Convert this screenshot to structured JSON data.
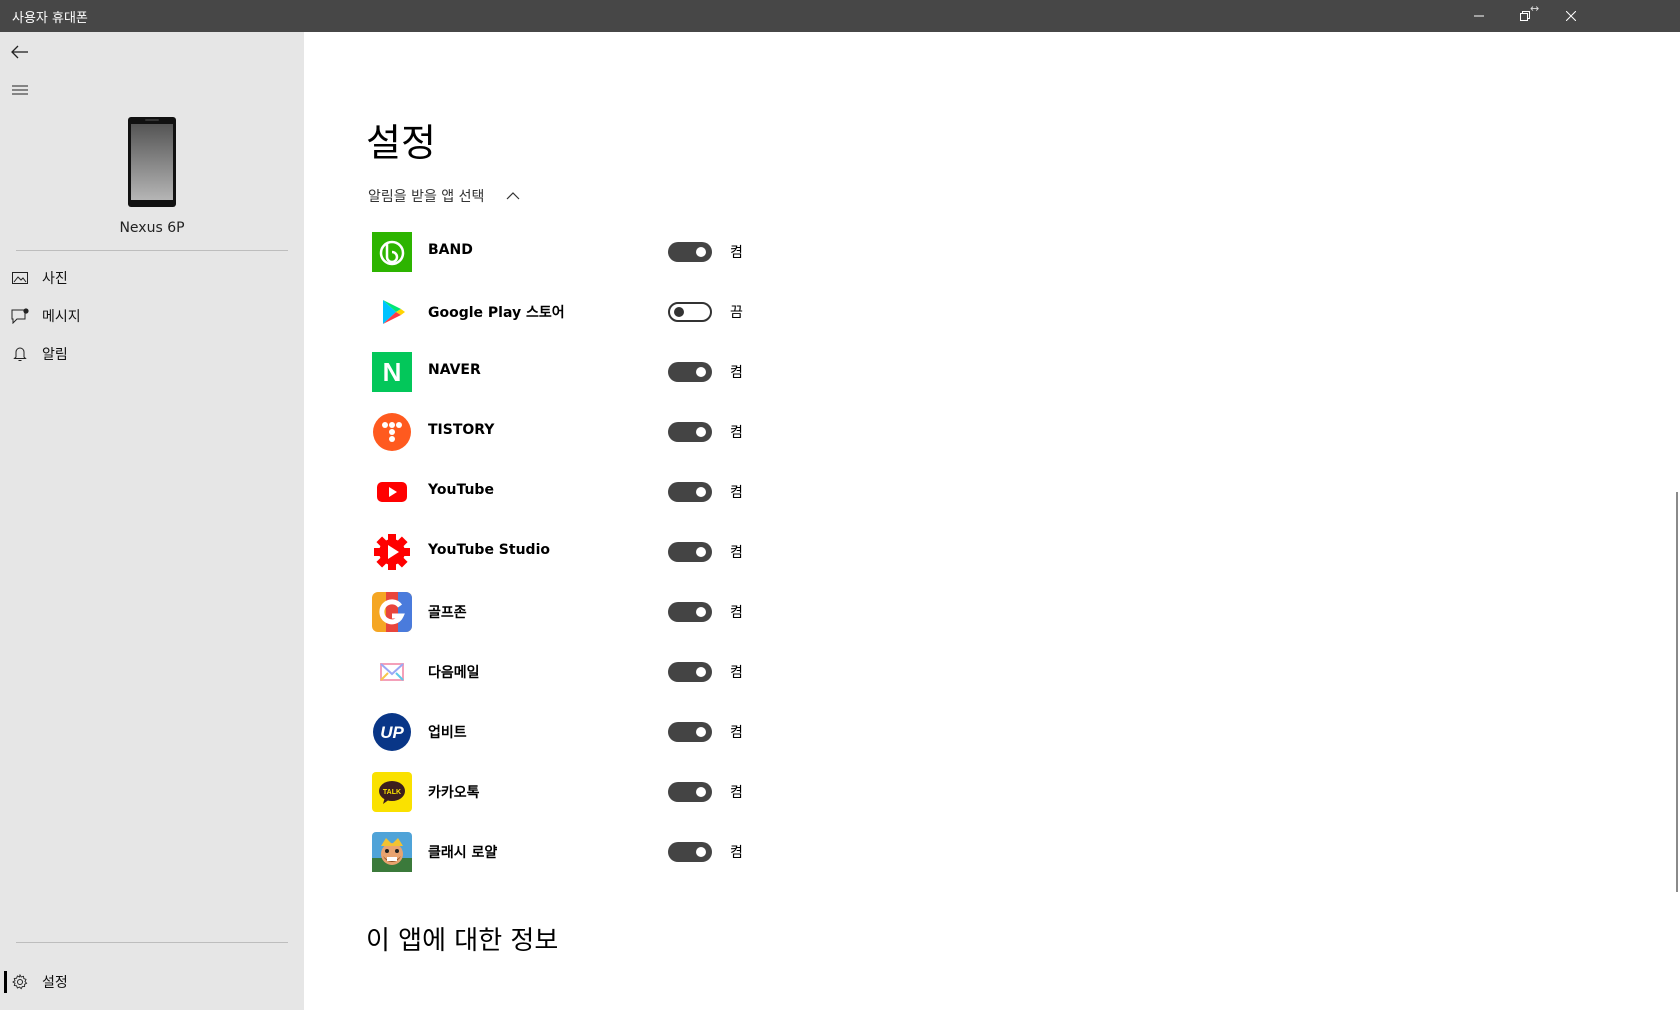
{
  "window": {
    "title": "사용자 휴대폰",
    "resize_hint": "↔"
  },
  "sidebar": {
    "device_name": "Nexus 6P",
    "nav": [
      {
        "label": "사진",
        "icon": "photo-icon"
      },
      {
        "label": "메시지",
        "icon": "message-icon"
      },
      {
        "label": "알림",
        "icon": "bell-icon"
      }
    ],
    "settings_label": "설정"
  },
  "main": {
    "title": "설정",
    "section_label": "알림을 받을 앱 선택",
    "apps": [
      {
        "name": "BAND",
        "state": "켬",
        "on": true,
        "icon": "band-icon"
      },
      {
        "name": "Google Play 스토어",
        "state": "끔",
        "on": false,
        "icon": "google-play-icon"
      },
      {
        "name": "NAVER",
        "state": "켬",
        "on": true,
        "icon": "naver-icon"
      },
      {
        "name": "TISTORY",
        "state": "켬",
        "on": true,
        "icon": "tistory-icon"
      },
      {
        "name": "YouTube",
        "state": "켬",
        "on": true,
        "icon": "youtube-icon"
      },
      {
        "name": "YouTube Studio",
        "state": "켬",
        "on": true,
        "icon": "youtube-studio-icon"
      },
      {
        "name": "골프존",
        "state": "켬",
        "on": true,
        "icon": "golfzon-icon"
      },
      {
        "name": "다음메일",
        "state": "켬",
        "on": true,
        "icon": "daum-mail-icon"
      },
      {
        "name": "업비트",
        "state": "켬",
        "on": true,
        "icon": "upbit-icon"
      },
      {
        "name": "카카오톡",
        "state": "켬",
        "on": true,
        "icon": "kakaotalk-icon"
      },
      {
        "name": "클래시 로얄",
        "state": "켬",
        "on": true,
        "icon": "clash-royale-icon"
      }
    ],
    "about_title": "이 앱에 대한 정보",
    "icon_texts": {
      "naver": "N",
      "upbit": "UP",
      "kakaotalk": "TALK"
    }
  },
  "colors": {
    "titlebar": "#474747",
    "sidebar": "#e6e6e6",
    "toggle_on": "#444444",
    "band": "#2db400",
    "naver": "#03c75a",
    "tistory": "#ff5a1f",
    "youtube": "#ff0000",
    "upbit": "#093687",
    "kakaotalk": "#fae100"
  }
}
